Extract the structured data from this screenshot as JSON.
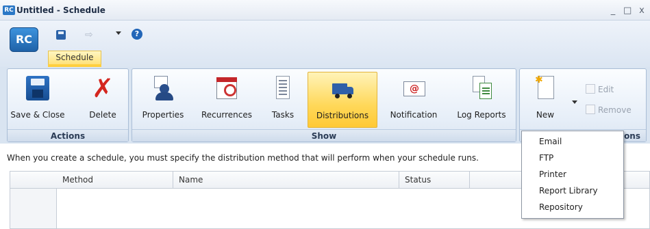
{
  "window": {
    "app_badge": "RC",
    "title": "Untitled - Schedule",
    "minimize": "_",
    "maximize": "□",
    "close": "x"
  },
  "app_button": {
    "label": "RC"
  },
  "quick_access": {
    "help": "?",
    "icons": [
      "save-icon",
      "forward-icon",
      "dropdown-icon",
      "help-icon"
    ]
  },
  "tabs": [
    {
      "label": "Schedule",
      "active": true
    }
  ],
  "ribbon": {
    "groups": {
      "actions": {
        "label": "Actions",
        "buttons": [
          {
            "label": "Save & Close",
            "icon": "save-icon"
          },
          {
            "label": "Delete",
            "icon": "delete-icon"
          }
        ]
      },
      "show": {
        "label": "Show",
        "buttons": [
          {
            "label": "Properties",
            "icon": "properties-icon"
          },
          {
            "label": "Recurrences",
            "icon": "recurrences-icon"
          },
          {
            "label": "Tasks",
            "icon": "tasks-icon"
          },
          {
            "label": "Distributions",
            "icon": "truck-icon",
            "active": true
          },
          {
            "label": "Notification",
            "icon": "email-icon"
          },
          {
            "label": "Log Reports",
            "icon": "log-reports-icon"
          }
        ]
      },
      "options": {
        "label": "ons",
        "new_label": "New",
        "edit_label": "Edit",
        "remove_label": "Remove"
      }
    }
  },
  "info_text": "When you create a schedule, you must specify the distribution method that will perform when your schedule runs.",
  "grid": {
    "columns": [
      "Method",
      "Name",
      "Status"
    ]
  },
  "new_menu": {
    "items": [
      "Email",
      "FTP",
      "Printer",
      "Report Library",
      "Repository"
    ]
  },
  "colors": {
    "accent_active": "#ffd85a",
    "ribbon_bg": "#d9e4f1",
    "delete_red": "#d4261f",
    "app_blue": "#2b78c6"
  }
}
